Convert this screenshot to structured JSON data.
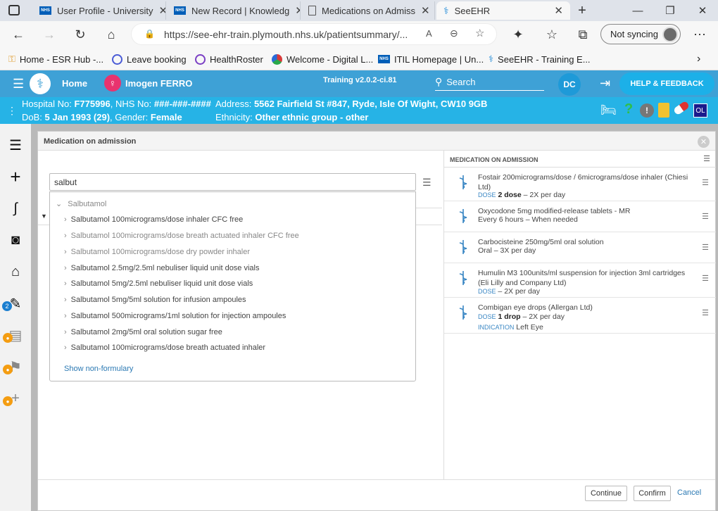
{
  "browser": {
    "tabs": [
      {
        "label": "User Profile - University",
        "icon": "nhs-logo"
      },
      {
        "label": "New Record | Knowledg",
        "icon": "nhs-logo"
      },
      {
        "label": "Medications on Admiss",
        "icon": "page-icon"
      },
      {
        "label": "SeeEHR",
        "icon": "seeehr-icon",
        "active": true
      }
    ],
    "url": "https://see-ehr-train.plymouth.nhs.uk/patientsummary/...",
    "sync_label": "Not syncing",
    "bookmarks": [
      {
        "label": "Home - ESR Hub -...",
        "icon_color": "#e2a23a"
      },
      {
        "label": "Leave booking",
        "icon_color": "#4a5bd6"
      },
      {
        "label": "HealthRoster",
        "icon_color": "#7b3fc4"
      },
      {
        "label": "Welcome - Digital L...",
        "icon_color": "#d83a3a"
      },
      {
        "label": "ITIL Homepage | Un...",
        "icon_color": "#005eb8"
      },
      {
        "label": "SeeEHR - Training E...",
        "icon_color": "#2a8fd8"
      }
    ]
  },
  "app": {
    "home_label": "Home",
    "patient_name": "Imogen FERRO",
    "version": "Training v2.0.2-ci.81",
    "search_label": "Search",
    "user_initials": "DC",
    "help_label": "HELP & FEEDBACK",
    "badge_ol": "OL",
    "colors": {
      "header": "#3ea1d6",
      "patient_bar": "#26b3e6",
      "accent": "#1cb0e8"
    }
  },
  "patient": {
    "hospital_label": "Hospital No:",
    "hospital_no": "F775996",
    "nhs_label": ", NHS No:",
    "nhs_no": "###-###-####",
    "address_label": "Address:",
    "address": "5562 Fairfield St #847, Ryde, Isle Of Wight, CW10 9GB",
    "dob_label": "DoB:",
    "dob": "5 Jan 1993 (29)",
    "gender_label": ", Gender:",
    "gender": "Female",
    "ethnicity_label": "Ethnicity:",
    "ethnicity": "Other ethnic group - other"
  },
  "sidebar": {
    "badge_count": "2"
  },
  "modal": {
    "title": "Medication on admission",
    "search_value": "salbut",
    "dropdown_header": "Salbutamol",
    "results": [
      {
        "label": "Salbutamol 100micrograms/dose inhaler CFC free",
        "grey": false
      },
      {
        "label": "Salbutamol 100micrograms/dose breath actuated inhaler CFC free",
        "grey": true
      },
      {
        "label": "Salbutamol 100micrograms/dose dry powder inhaler",
        "grey": true
      },
      {
        "label": "Salbutamol 2.5mg/2.5ml nebuliser liquid unit dose vials",
        "grey": false
      },
      {
        "label": "Salbutamol 5mg/2.5ml nebuliser liquid unit dose vials",
        "grey": false
      },
      {
        "label": "Salbutamol 5mg/5ml solution for infusion ampoules",
        "grey": false
      },
      {
        "label": "Salbutamol 500micrograms/1ml solution for injection ampoules",
        "grey": false
      },
      {
        "label": "Salbutamol 2mg/5ml oral solution sugar free",
        "grey": false
      },
      {
        "label": "Salbutamol 100micrograms/dose breath actuated inhaler",
        "grey": false
      }
    ],
    "show_nonformulary": "Show non-formulary",
    "panel_title": "MEDICATION ON ADMISSION",
    "medications": [
      {
        "name": "Fostair 200micrograms/dose / 6micrograms/dose inhaler (Chiesi Ltd)",
        "line1_label": "DOSE",
        "line1_bold": "2 dose",
        "line1_rest": " – 2X per day",
        "line2_label": "",
        "line2_text": ""
      },
      {
        "name": "Oxycodone 5mg modified-release tablets - MR",
        "line1_label": "",
        "line1_bold": "",
        "line1_rest": "Every 6 hours – When needed",
        "line2_label": "",
        "line2_text": ""
      },
      {
        "name": "Carbocisteine 250mg/5ml oral solution",
        "line1_label": "",
        "line1_bold": "",
        "line1_rest": "Oral – 3X per day",
        "line2_label": "",
        "line2_text": ""
      },
      {
        "name": "Humulin M3 100units/ml suspension for injection 3ml cartridges (Eli Lilly and Company Ltd)",
        "line1_label": "DOSE",
        "line1_bold": "",
        "line1_rest": " – 2X per day",
        "line2_label": "",
        "line2_text": ""
      },
      {
        "name": "Combigan eye drops (Allergan Ltd)",
        "line1_label": "DOSE",
        "line1_bold": "1 drop",
        "line1_rest": " – 2X per day",
        "line2_label": "INDICATION",
        "line2_text": "Left Eye"
      }
    ],
    "buttons": {
      "continue": "Continue",
      "confirm": "Confirm",
      "cancel": "Cancel"
    }
  }
}
